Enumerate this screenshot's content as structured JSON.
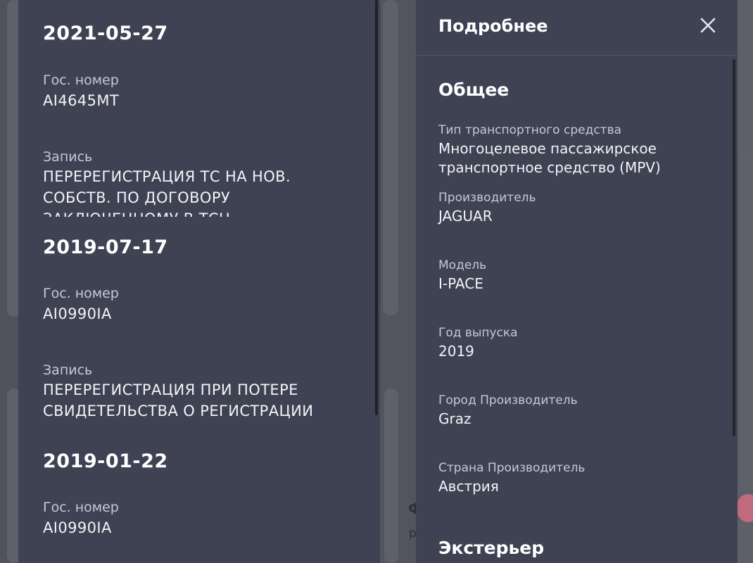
{
  "left": {
    "records": [
      {
        "date": "2021-05-27",
        "plate_label": "Гос. номер",
        "plate": "AI4645MT",
        "record_label": "Запись",
        "record": "ПЕРЕРЕГИСТРАЦИЯ ТС НА НОВ. СОБСТВ. ПО ДОГОВОРУ ЗАКЛЮЧЕННОМУ В ТСЦ"
      },
      {
        "date": "2019-07-17",
        "plate_label": "Гос. номер",
        "plate": "AI0990IA",
        "record_label": "Запись",
        "record": "ПЕРЕРЕГИСТРАЦИЯ ПРИ ПОТЕРЕ СВИДЕТЕЛЬСТВА О РЕГИСТРАЦИИ"
      },
      {
        "date": "2019-01-22",
        "plate_label": "Гос. номер",
        "plate": "AI0990IA"
      }
    ]
  },
  "right": {
    "title": "Подробнее",
    "close_icon": "close-icon",
    "section_general": "Общее",
    "fields": [
      {
        "label": "Тип транспортного средства",
        "value": "Многоцелевое пассажирское транспортное средство (MPV)"
      },
      {
        "label": "Производитель",
        "value": "JAGUAR"
      },
      {
        "label": "Модель",
        "value": "I-PACE"
      },
      {
        "label": "Год выпуска",
        "value": "2019"
      },
      {
        "label": "Город Производитель",
        "value": "Graz"
      },
      {
        "label": "Страна Производитель",
        "value": "Австрия"
      }
    ],
    "section_exterior": "Экстерьер"
  },
  "colors": {
    "panel": "#3e4252",
    "backdrop": "#52555d",
    "accent_pink": "#c06a7d"
  }
}
